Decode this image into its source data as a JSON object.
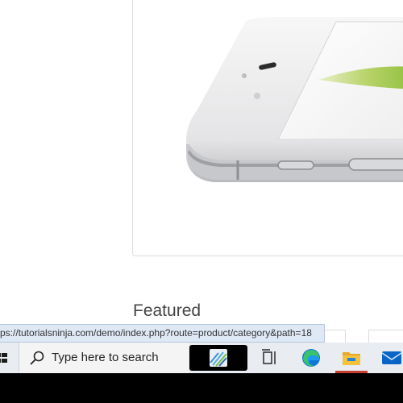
{
  "page": {
    "featured_heading": "Featured"
  },
  "status_bar": {
    "url": "ps://tutorialsninja.com/demo/index.php?route=product/category&path=18"
  },
  "taskbar": {
    "search_placeholder": "Type here to search",
    "icons": [
      "windows-start-icon",
      "search-icon",
      "widgets-icon",
      "task-view-icon",
      "edge-icon",
      "file-explorer-icon",
      "mail-icon"
    ],
    "active_app": "file-explorer"
  },
  "colors": {
    "taskbar_bg": "#e9ecf1",
    "status_bg": "#dfe9f6",
    "edge_blue": "#0f78d4",
    "edge_green": "#3bc36b",
    "folder_yellow": "#f3c23f",
    "active_indicator": "#c8402f"
  }
}
